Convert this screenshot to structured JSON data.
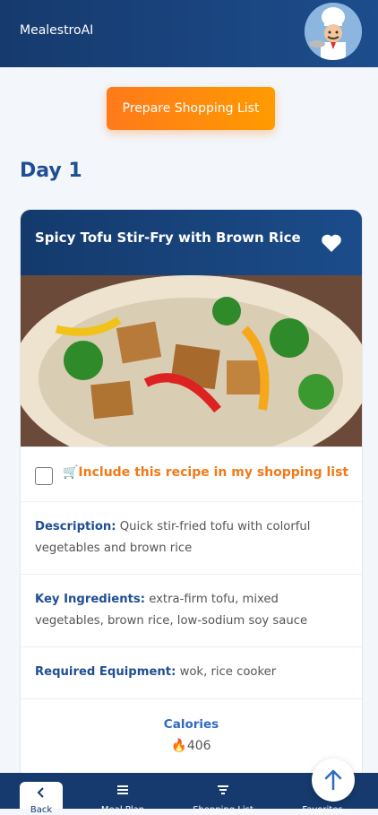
{
  "header": {
    "brand": "MealestroAI",
    "avatar_icon": "chef-avatar-icon"
  },
  "actions": {
    "prepare_label": "Prepare Shopping List"
  },
  "plan": {
    "day_label": "Day 1"
  },
  "recipe": {
    "title": "Spicy Tofu Stir-Fry with Brown Rice",
    "favorite_icon": "heart-icon",
    "image_icon": "food-photo",
    "include_label": "🛒Include this recipe in my shopping list",
    "description_label": "Description:",
    "description": "Quick stir-fried tofu with colorful vegetables and brown rice",
    "ingredients_label": "Key Ingredients:",
    "ingredients": "extra-firm tofu, mixed vegetables, brown rice, low-sodium soy sauce",
    "equipment_label": "Required Equipment:",
    "equipment": "wok, rice cooker",
    "calories_label": "Calories",
    "calories_value": "🔥406"
  },
  "nav": {
    "items": [
      {
        "label": "Back",
        "icon": "chevron-left-icon"
      },
      {
        "label": "Meal Plan",
        "icon": "list-icon"
      },
      {
        "label": "Shopping List",
        "icon": "filter-icon"
      },
      {
        "label": "Favorites",
        "icon": "heart-icon"
      }
    ]
  },
  "colors": {
    "primary": "#1d4d8c",
    "accent": "#ff8a00",
    "link": "#2f6ac2"
  }
}
